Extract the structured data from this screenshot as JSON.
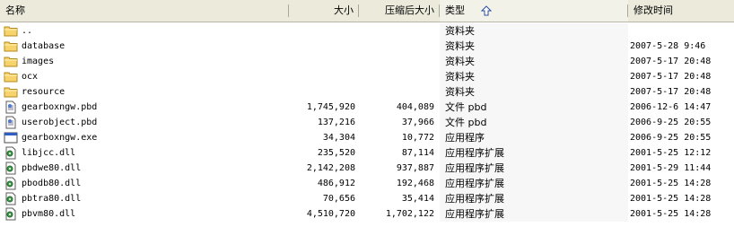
{
  "columns": {
    "name": "名称",
    "size": "大小",
    "compressed_size": "压缩后大小",
    "type": "类型",
    "modified": "修改时间"
  },
  "sort_column": "type",
  "sort_direction": "ascending",
  "files": [
    {
      "name": "..",
      "size": "",
      "compressed": "",
      "type": "资料夹",
      "date": "",
      "icon": "folder-icon"
    },
    {
      "name": "database",
      "size": "",
      "compressed": "",
      "type": "资料夹",
      "date": "2007-5-28 9:46",
      "icon": "folder-icon"
    },
    {
      "name": "images",
      "size": "",
      "compressed": "",
      "type": "资料夹",
      "date": "2007-5-17 20:48",
      "icon": "folder-icon"
    },
    {
      "name": "ocx",
      "size": "",
      "compressed": "",
      "type": "资料夹",
      "date": "2007-5-17 20:48",
      "icon": "folder-icon"
    },
    {
      "name": "resource",
      "size": "",
      "compressed": "",
      "type": "资料夹",
      "date": "2007-5-17 20:48",
      "icon": "folder-icon"
    },
    {
      "name": "gearboxngw.pbd",
      "size": "1,745,920",
      "compressed": "404,089",
      "type": "文件 pbd",
      "date": "2006-12-6 14:47",
      "icon": "document-icon"
    },
    {
      "name": "userobject.pbd",
      "size": "137,216",
      "compressed": "37,966",
      "type": "文件 pbd",
      "date": "2006-9-25 20:55",
      "icon": "document-icon"
    },
    {
      "name": "gearboxngw.exe",
      "size": "34,304",
      "compressed": "10,772",
      "type": "应用程序",
      "date": "2006-9-25 20:55",
      "icon": "application-icon"
    },
    {
      "name": "libjcc.dll",
      "size": "235,520",
      "compressed": "87,114",
      "type": "应用程序扩展",
      "date": "2001-5-25 12:12",
      "icon": "dll-icon"
    },
    {
      "name": "pbdwe80.dll",
      "size": "2,142,208",
      "compressed": "937,887",
      "type": "应用程序扩展",
      "date": "2001-5-29 11:44",
      "icon": "dll-icon"
    },
    {
      "name": "pbodb80.dll",
      "size": "486,912",
      "compressed": "192,468",
      "type": "应用程序扩展",
      "date": "2001-5-25 14:28",
      "icon": "dll-icon"
    },
    {
      "name": "pbtra80.dll",
      "size": "70,656",
      "compressed": "35,414",
      "type": "应用程序扩展",
      "date": "2001-5-25 14:28",
      "icon": "dll-icon"
    },
    {
      "name": "pbvm80.dll",
      "size": "4,510,720",
      "compressed": "1,702,122",
      "type": "应用程序扩展",
      "date": "2001-5-25 14:28",
      "icon": "dll-icon"
    }
  ]
}
